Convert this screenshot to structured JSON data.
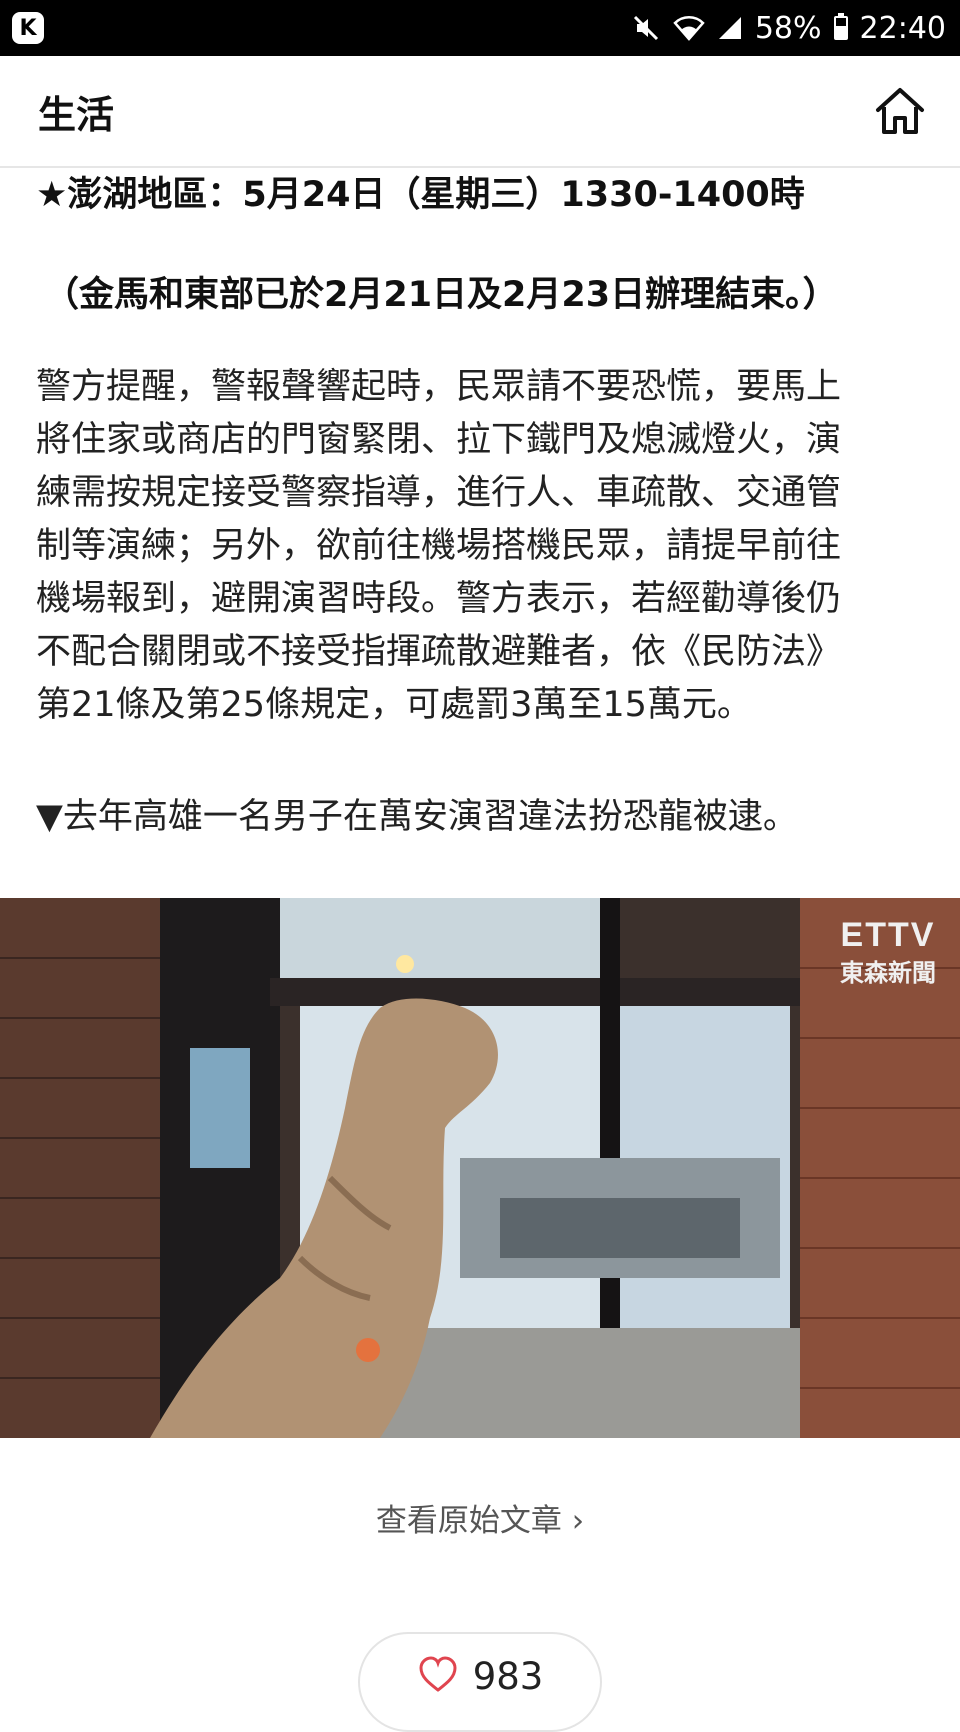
{
  "status_bar": {
    "app_badge": "K",
    "battery_percent": "58%",
    "time": "22:40",
    "icons": [
      "mute-icon",
      "wifi-icon",
      "signal-icon",
      "battery-icon"
    ]
  },
  "header": {
    "title": "生活",
    "home_icon": "home-icon"
  },
  "article": {
    "schedule_line": "★澎湖地區：5月24日（星期三）1330-1400時",
    "note_line": "（金馬和東部已於2月21日及2月23日辦理結束。）",
    "paragraph_lines": [
      "警方提醒，警報聲響起時，民眾請不要恐慌，要馬上",
      "將住家或商店的門窗緊閉、拉下鐵門及熄滅燈火，演",
      "練需按規定接受警察指導，進行人、車疏散、交通管",
      "制等演練；另外，欲前往機場搭機民眾，請提早前往",
      "機場報到，避開演習時段。警方表示，若經勸導後仍",
      "不配合關閉或不接受指揮疏散避難者，依《民防法》",
      "第21條及第25條規定，可處罰3萬至15萬元。"
    ],
    "photo_caption": "▼去年高雄一名男子在萬安演習違法扮恐龍被逮。"
  },
  "photo": {
    "watermark_brand": "ETTV",
    "watermark_sub": "東森新聞"
  },
  "footer": {
    "view_original": "查看原始文章",
    "like_count": "983"
  },
  "colors": {
    "status_bar": "#000000",
    "heart": "#e0454f",
    "text": "#222222"
  }
}
